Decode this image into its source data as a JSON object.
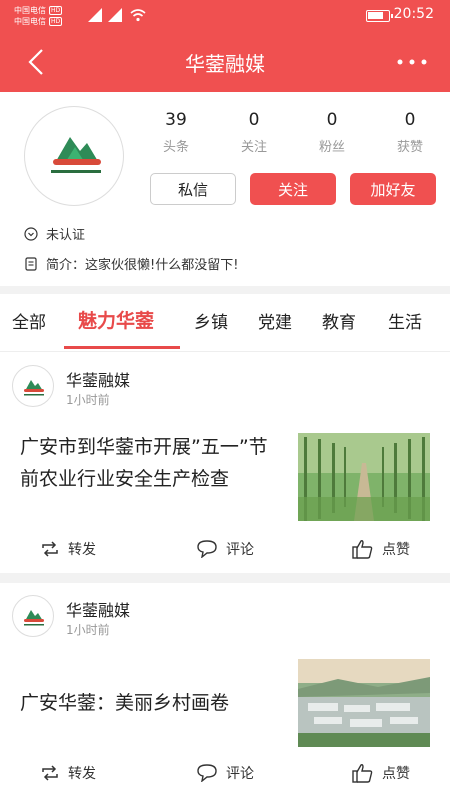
{
  "status_bar": {
    "carrier_1": "中国电信",
    "carrier_2": "中国电信",
    "network_badge": "HD",
    "battery_percent": 80,
    "time": "20:52"
  },
  "nav": {
    "title": "华蓥融媒",
    "back_icon": "chevron-left-icon",
    "more_icon": "more-dots-icon"
  },
  "profile": {
    "stats": [
      {
        "value": "39",
        "label": "头条"
      },
      {
        "value": "0",
        "label": "关注"
      },
      {
        "value": "0",
        "label": "粉丝"
      },
      {
        "value": "0",
        "label": "获赞"
      }
    ],
    "buttons": {
      "message": "私信",
      "follow": "关注",
      "add_friend": "加好友"
    },
    "verify_status": "未认证",
    "bio": "简介：这家伙很懒!什么都没留下!"
  },
  "tabs": {
    "items": [
      "全部",
      "魅力华蓥",
      "乡镇",
      "党建",
      "教育",
      "生活"
    ],
    "active_index": 1
  },
  "feed": [
    {
      "author": "华蓥融媒",
      "time": "1小时前",
      "title": "广安市到华蓥市开展”五一”节前农业行业安全生产检查",
      "actions": {
        "share": "转发",
        "comment": "评论",
        "like": "点赞"
      }
    },
    {
      "author": "华蓥融媒",
      "time": "1小时前",
      "title": "广安华蓥：美丽乡村画卷",
      "actions": {
        "share": "转发",
        "comment": "评论",
        "like": "点赞"
      }
    }
  ],
  "colors": {
    "brand_red": "#f05050",
    "tab_active": "#e84a4a",
    "muted_text": "#999999"
  }
}
